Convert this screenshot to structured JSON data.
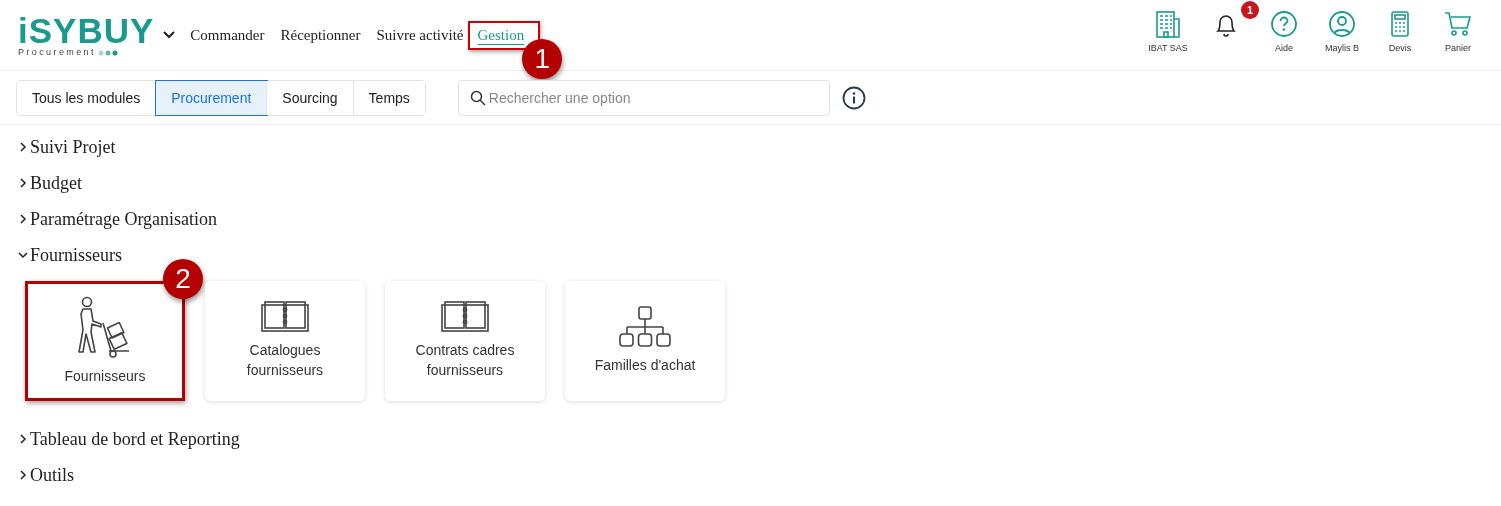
{
  "logo": {
    "name": "iSYBUY",
    "subtitle": "Procurement"
  },
  "nav": [
    {
      "label": "Commander",
      "selected": false,
      "highlighted": false
    },
    {
      "label": "Réceptionner",
      "selected": false,
      "highlighted": false
    },
    {
      "label": "Suivre activité",
      "selected": false,
      "highlighted": false
    },
    {
      "label": "Gestion",
      "selected": true,
      "highlighted": true,
      "callout": "1"
    }
  ],
  "toolbar": [
    {
      "kind": "building",
      "label": "IBAT SAS"
    },
    {
      "kind": "bell",
      "badge": "1"
    },
    {
      "kind": "help",
      "label": "Aide"
    },
    {
      "kind": "user",
      "label": "Maylis B"
    },
    {
      "kind": "calculator",
      "label": "Devis"
    },
    {
      "kind": "cart",
      "label": "Panier"
    }
  ],
  "tabs": [
    {
      "label": "Tous les modules",
      "selected": false
    },
    {
      "label": "Procurement",
      "selected": true
    },
    {
      "label": "Sourcing",
      "selected": false
    },
    {
      "label": "Temps",
      "selected": false
    }
  ],
  "search": {
    "placeholder": "Rechercher une option"
  },
  "sections": [
    {
      "title": "Suivi Projet",
      "expanded": false
    },
    {
      "title": "Budget",
      "expanded": false
    },
    {
      "title": "Paramétrage Organisation",
      "expanded": false
    },
    {
      "title": "Fournisseurs",
      "expanded": true,
      "tiles": [
        {
          "kind": "hand-truck",
          "label": "Fournisseurs",
          "highlighted": true,
          "callout": "2"
        },
        {
          "kind": "book",
          "label": "Catalogues fournisseurs",
          "highlighted": false
        },
        {
          "kind": "book",
          "label": "Contrats cadres fournisseurs",
          "highlighted": false
        },
        {
          "kind": "org-chart",
          "label": "Familles d'achat",
          "highlighted": false
        }
      ]
    },
    {
      "title": "Tableau de bord et Reporting",
      "expanded": false
    },
    {
      "title": "Outils",
      "expanded": false
    }
  ]
}
